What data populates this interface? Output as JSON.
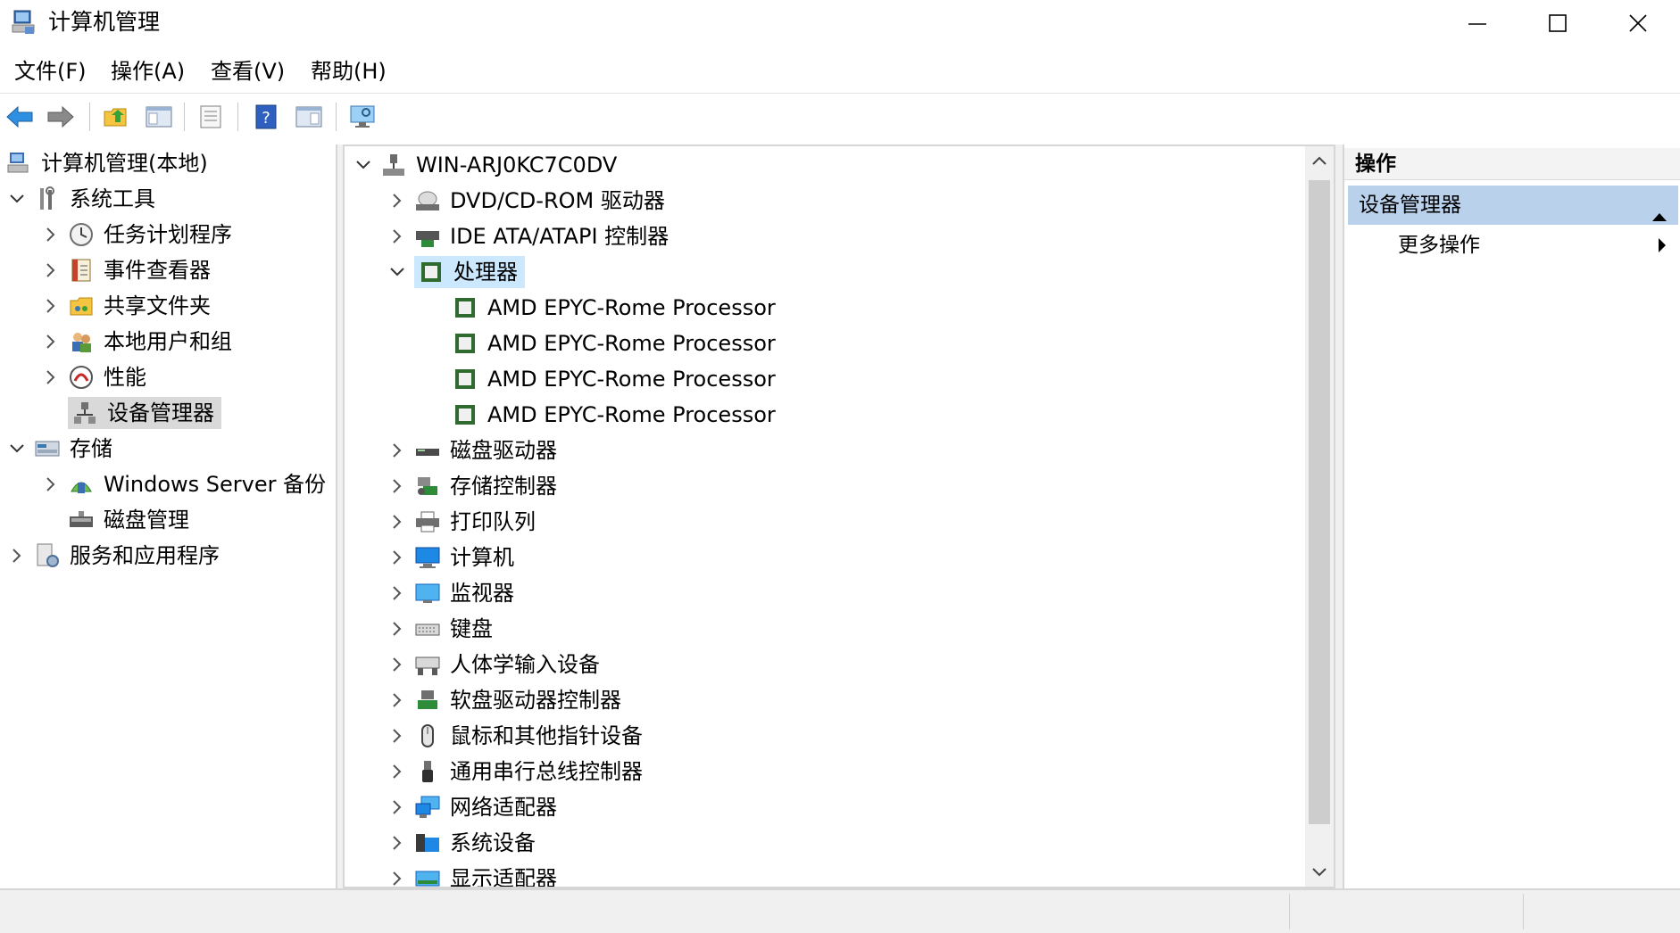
{
  "window": {
    "title": "计算机管理",
    "minimize_glyph": "─",
    "maximize_glyph": "☐",
    "close_glyph": "✕"
  },
  "menu": [
    "文件(F)",
    "操作(A)",
    "查看(V)",
    "帮助(H)"
  ],
  "toolbar": [
    "back-arrow-icon",
    "forward-arrow-icon",
    "up-folder-icon",
    "show-hide-console-tree-icon",
    "properties-icon",
    "help-icon",
    "show-action-pane-icon",
    "monitor-icon"
  ],
  "left_tree": {
    "root": "计算机管理(本地)",
    "system_tools": "系统工具",
    "task_scheduler": "任务计划程序",
    "event_viewer": "事件查看器",
    "shared_folders": "共享文件夹",
    "local_users": "本地用户和组",
    "performance": "性能",
    "device_manager": "设备管理器",
    "storage": "存储",
    "windows_backup": "Windows Server 备份",
    "disk_management": "磁盘管理",
    "services_apps": "服务和应用程序"
  },
  "device_tree": {
    "computer": "WIN-ARJ0KC7C0DV",
    "dvd": "DVD/CD-ROM 驱动器",
    "ide": "IDE ATA/ATAPI 控制器",
    "processors": "处理器",
    "cpu_items": [
      "AMD EPYC-Rome Processor",
      "AMD EPYC-Rome Processor",
      "AMD EPYC-Rome Processor",
      "AMD EPYC-Rome Processor"
    ],
    "categories": [
      "磁盘驱动器",
      "存储控制器",
      "打印队列",
      "计算机",
      "监视器",
      "键盘",
      "人体学输入设备",
      "软盘驱动器控制器",
      "鼠标和其他指针设备",
      "通用串行总线控制器",
      "网络适配器",
      "系统设备",
      "显示适配器"
    ]
  },
  "actions": {
    "header": "操作",
    "section": "设备管理器",
    "more": "更多操作"
  }
}
